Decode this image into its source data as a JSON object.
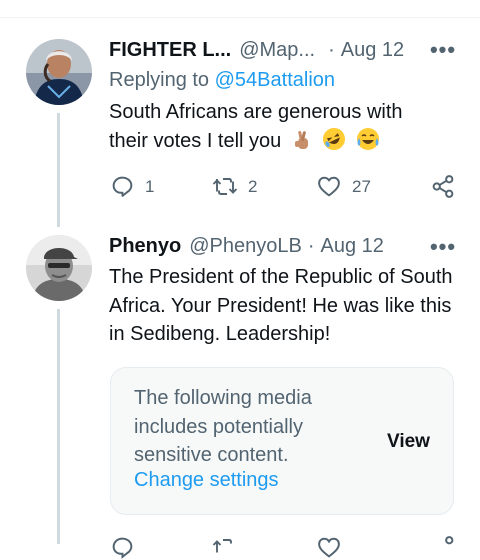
{
  "tweets": [
    {
      "name": "FIGHTER L...",
      "handle": "@Map...",
      "separator": "·",
      "date": "Aug 12",
      "replying_prefix": "Replying to ",
      "replying_to": "@54Battalion",
      "text_line1": "South Africans are generous with",
      "text_line2": "their votes I tell you",
      "emoji_icons": [
        "crossed-fingers-icon",
        "rolling-laughing-icon",
        "tears-of-joy-icon"
      ],
      "replies": "1",
      "retweets": "2",
      "likes": "27"
    },
    {
      "name": "Phenyo",
      "handle": "@PhenyoLB",
      "separator": "·",
      "date": "Aug 12",
      "text": "The President of the Republic of South Africa. Your President! He was like this in Sedibeng. Leadership!",
      "media_warning": "The following media includes potentially sensitive content.",
      "media_link": "Change settings",
      "media_view": "View"
    }
  ],
  "more_glyph": "•••",
  "colors": {
    "accent": "#1d9bf0",
    "text": "#0f1419",
    "secondary": "#536471",
    "thread_line": "#cfd9de"
  }
}
